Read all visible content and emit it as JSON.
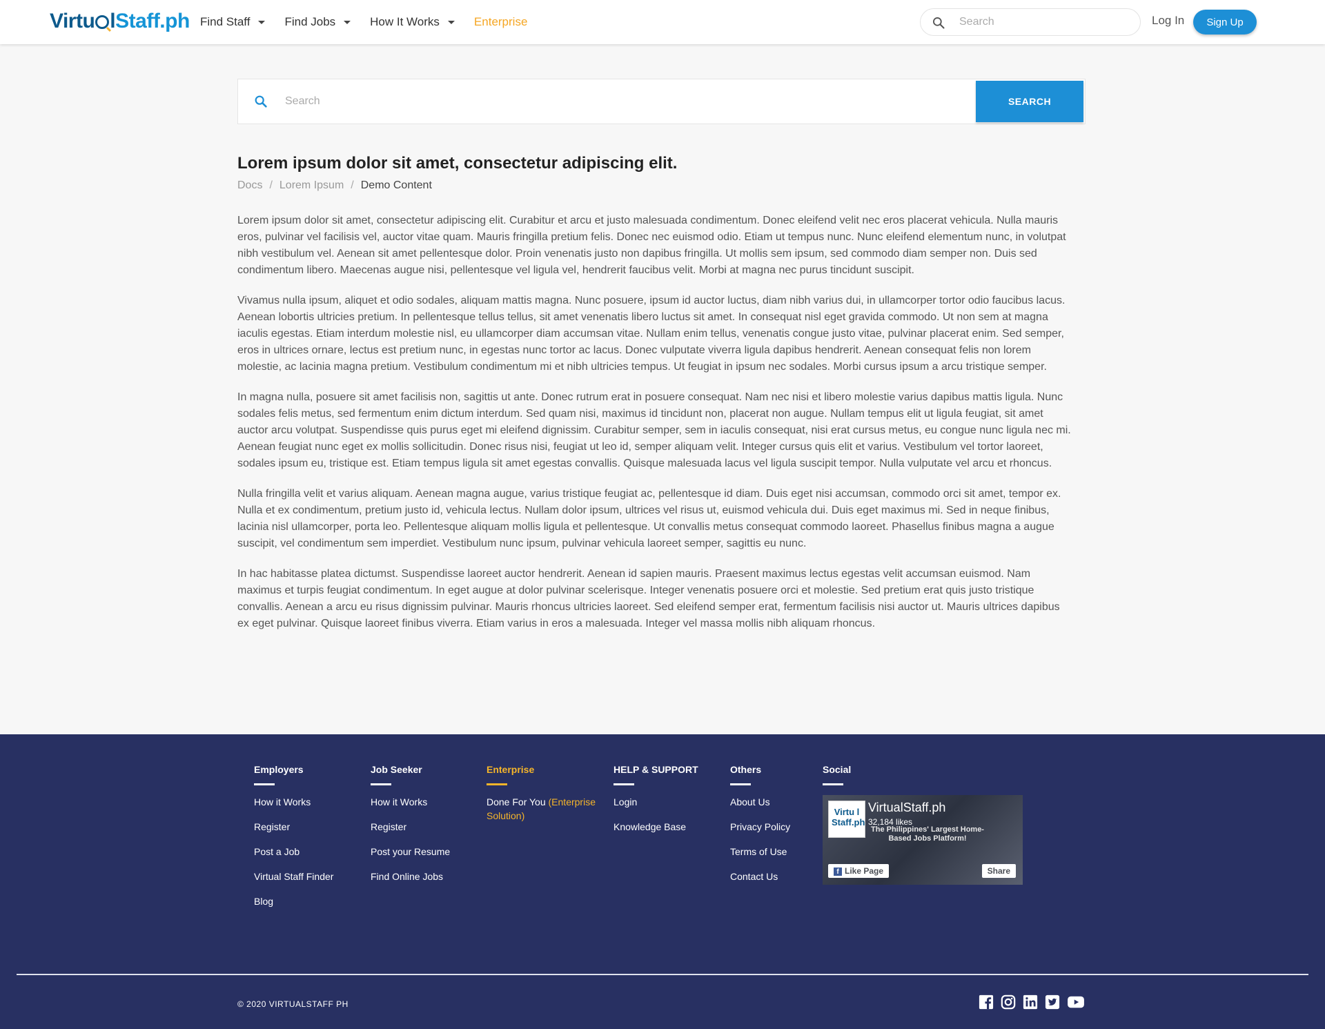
{
  "header": {
    "logo_part1": "Virtu",
    "logo_part2": "l",
    "logo_part3": "Staff.ph",
    "nav": [
      {
        "label": "Find Staff"
      },
      {
        "label": "Find Jobs"
      },
      {
        "label": "How It Works"
      },
      {
        "label": "Enterprise"
      }
    ],
    "search_placeholder": "Search",
    "login": "Log In",
    "signup": "Sign Up"
  },
  "main_search": {
    "placeholder": "Search",
    "button": "SEARCH"
  },
  "article": {
    "title": "Lorem ipsum dolor sit amet, consectetur adipiscing elit.",
    "breadcrumb": [
      "Docs",
      "Lorem Ipsum",
      "Demo Content"
    ],
    "paragraphs": [
      "Lorem ipsum dolor sit amet, consectetur adipiscing elit. Curabitur et arcu et justo malesuada condimentum. Donec eleifend velit nec eros placerat vehicula. Nulla mauris eros, pulvinar vel facilisis vel, auctor vitae quam. Mauris fringilla pretium felis. Donec nec euismod odio. Etiam ut tempus nunc. Nunc eleifend elementum nunc, in volutpat nibh vestibulum vel. Aenean sit amet pellentesque dolor. Proin venenatis justo non dapibus fringilla. Ut mollis sem ipsum, sed commodo diam semper non. Duis sed condimentum libero. Maecenas augue nisi, pellentesque vel ligula vel, hendrerit faucibus velit. Morbi at magna nec purus tincidunt suscipit.",
      "Vivamus nulla ipsum, aliquet et odio sodales, aliquam mattis magna. Nunc posuere, ipsum id auctor luctus, diam nibh varius dui, in ullamcorper tortor odio faucibus lacus. Aenean lobortis ultricies pretium. In pellentesque tellus tellus, sit amet venenatis libero luctus sit amet. In consequat nisl eget gravida commodo. Ut non sem at magna iaculis egestas. Etiam interdum molestie nisl, eu ullamcorper diam accumsan vitae. Nullam enim tellus, venenatis congue justo vitae, pulvinar placerat enim. Sed semper, eros in ultrices ornare, lectus est pretium nunc, in egestas nunc tortor ac lacus. Donec vulputate viverra ligula dapibus hendrerit. Aenean consequat felis non lorem molestie, ac lacinia magna pretium. Vestibulum condimentum mi et nibh ultricies tempus. Ut feugiat in ipsum nec sodales. Morbi cursus ipsum a arcu tristique semper.",
      "In magna nulla, posuere sit amet facilisis non, sagittis ut ante. Donec rutrum erat in posuere consequat. Nam nec nisi et libero molestie varius dapibus mattis ligula. Nunc sodales felis metus, sed fermentum enim dictum interdum. Sed quam nisi, maximus id tincidunt non, placerat non augue. Nullam tempus elit ut ligula feugiat, sit amet auctor arcu volutpat. Suspendisse quis purus eget mi eleifend dignissim. Curabitur semper, sem in iaculis consequat, nisi erat cursus metus, eu congue nunc ligula nec mi. Aenean feugiat nunc eget ex mollis sollicitudin. Donec risus nisi, feugiat ut leo id, semper aliquam velit. Integer cursus quis elit et varius. Vestibulum vel tortor laoreet, sodales ipsum eu, tristique est. Etiam tempus ligula sit amet egestas convallis. Quisque malesuada lacus vel ligula suscipit tempor. Nulla vulputate vel arcu et rhoncus.",
      "Nulla fringilla velit et varius aliquam. Aenean magna augue, varius tristique feugiat ac, pellentesque id diam. Duis eget nisi accumsan, commodo orci sit amet, tempor ex. Nulla et ex condimentum, pretium justo id, vehicula lectus. Nullam dolor ipsum, ultrices vel risus ut, euismod vehicula dui. Duis eget maximus mi. Sed in neque finibus, lacinia nisl ullamcorper, porta leo. Pellentesque aliquam mollis ligula et pellentesque. Ut convallis metus consequat commodo laoreet. Phasellus finibus magna a augue suscipit, vel condimentum sem imperdiet. Vestibulum nunc ipsum, pulvinar vehicula laoreet semper, sagittis eu nunc.",
      "In hac habitasse platea dictumst. Suspendisse laoreet auctor hendrerit. Aenean id sapien mauris. Praesent maximus lectus egestas velit accumsan euismod. Nam maximus et turpis feugiat condimentum. In eget augue at dolor pulvinar scelerisque. Integer venenatis posuere orci et molestie. Sed pretium erat quis justo tristique convallis. Aenean a arcu eu risus dignissim pulvinar. Mauris rhoncus ultricies laoreet. Sed eleifend semper erat, fermentum facilisis nisi auctor ut. Mauris ultrices dapibus ex eget pulvinar. Quisque laoreet finibus viverra. Etiam varius in eros a malesuada. Integer vel massa mollis nibh aliquam rhoncus."
    ]
  },
  "footer": {
    "employers": {
      "title": "Employers",
      "links": [
        "How it Works",
        "Register",
        "Post a Job",
        "Virtual Staff Finder",
        "Blog"
      ]
    },
    "job_seeker": {
      "title": "Job Seeker",
      "links": [
        "How it Works",
        "Register",
        "Post your Resume",
        "Find Online Jobs"
      ]
    },
    "enterprise": {
      "title": "Enterprise",
      "link_main": "Done For You ",
      "link_accent": "(Enterprise Solution)"
    },
    "help": {
      "title": "HELP & SUPPORT",
      "links": [
        "Login",
        "Knowledge Base"
      ]
    },
    "others": {
      "title": "Others",
      "links": [
        "About Us",
        "Privacy Policy",
        "Terms of Use",
        "Contact Us"
      ]
    },
    "social": {
      "title": "Social",
      "fb_logo_l1": "Virtu l",
      "fb_logo_l2": "Staff.ph",
      "fb_name": "VirtualStaff.ph",
      "fb_likes": "32,184 likes",
      "fb_tagline": "The Philippines' Largest Home-Based Jobs Platform!",
      "fb_like_btn": "Like Page",
      "fb_share_btn": "Share"
    },
    "copyright": "© 2020 VIRTUALSTAFF PH",
    "social_icons": [
      "facebook-icon",
      "instagram-icon",
      "linkedin-icon",
      "twitter-icon",
      "youtube-icon"
    ]
  },
  "colors": {
    "brand_blue": "#1d8fd6",
    "brand_dark": "#0d5a8c",
    "accent_yellow": "#f5a623",
    "footer_bg": "#283062"
  }
}
